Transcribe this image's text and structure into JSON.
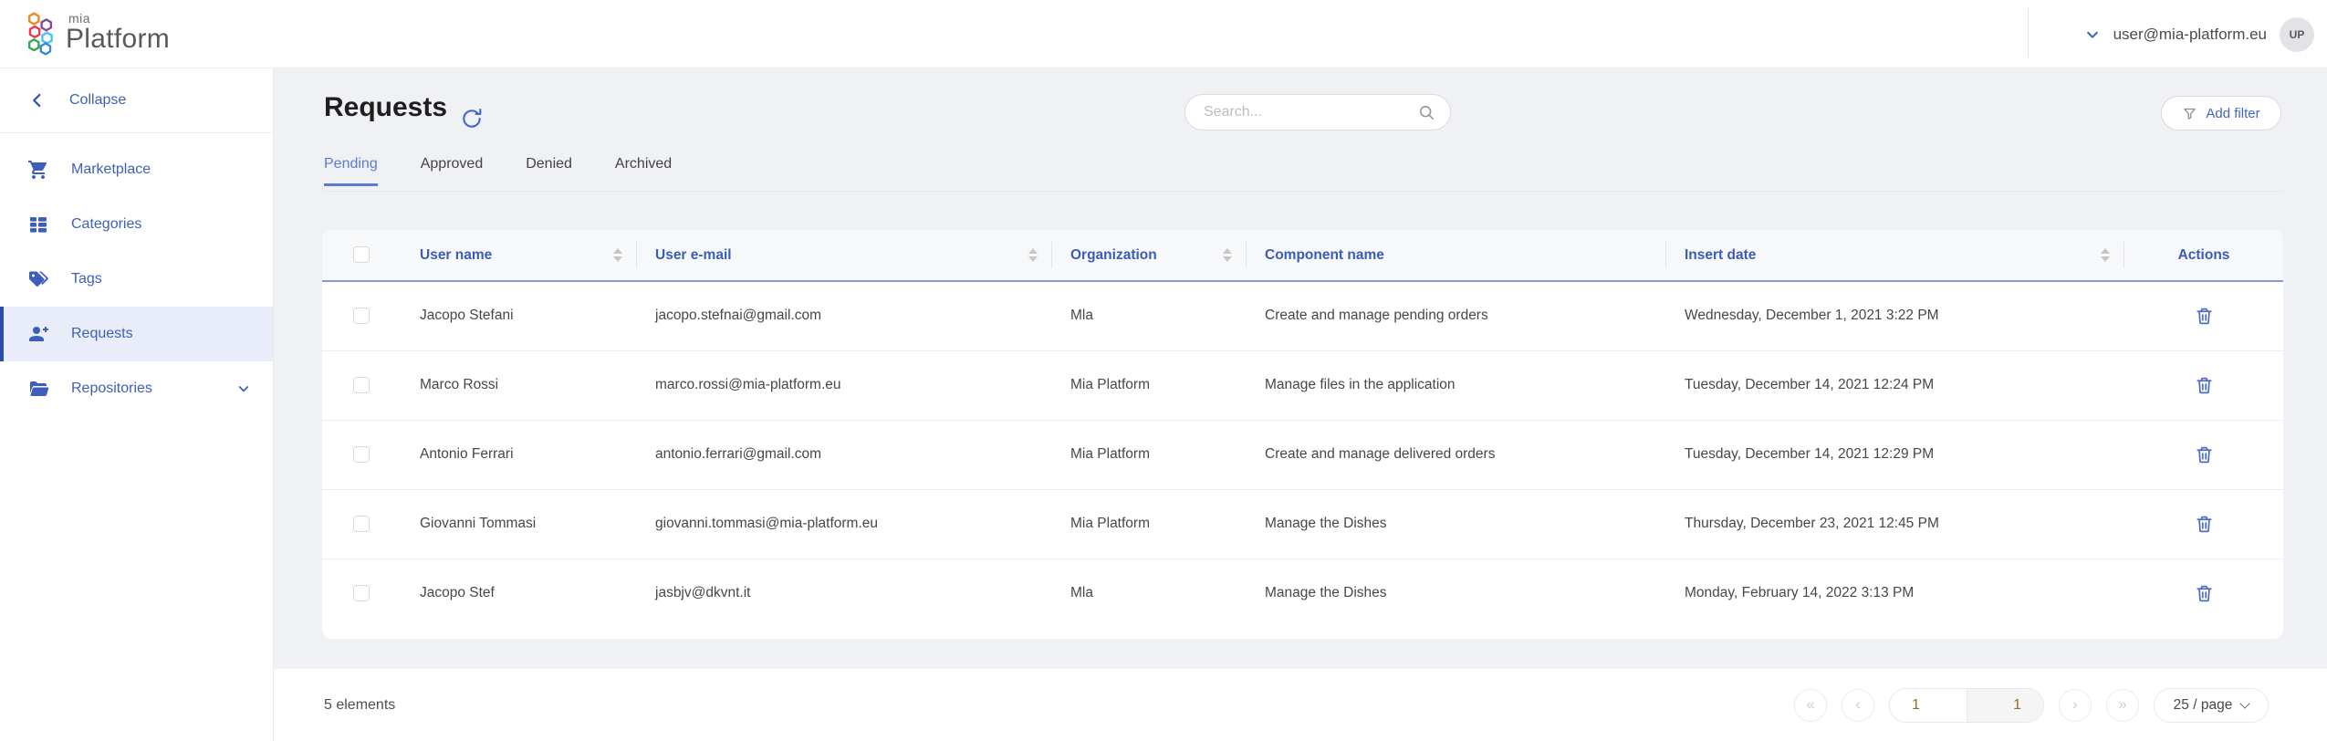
{
  "topbar": {
    "brand": {
      "top": "mia",
      "bottom": "Platform"
    },
    "user": {
      "email": "user@mia-platform.eu",
      "initials": "UP"
    }
  },
  "sidebar": {
    "collapse_label": "Collapse",
    "items": [
      {
        "label": "Marketplace",
        "icon": "cart-icon",
        "active": false
      },
      {
        "label": "Categories",
        "icon": "list-icon",
        "active": false
      },
      {
        "label": "Tags",
        "icon": "tags-icon",
        "active": false
      },
      {
        "label": "Requests",
        "icon": "user-add-icon",
        "active": true
      },
      {
        "label": "Repositories",
        "icon": "folder-icon",
        "active": false,
        "has_submenu": true
      }
    ]
  },
  "page": {
    "title": "Requests",
    "tabs": [
      {
        "label": "Pending",
        "active": true
      },
      {
        "label": "Approved",
        "active": false
      },
      {
        "label": "Denied",
        "active": false
      },
      {
        "label": "Archived",
        "active": false
      }
    ],
    "search_placeholder": "Search...",
    "add_filter_label": "Add filter"
  },
  "table": {
    "columns": [
      {
        "label": "User name",
        "sortable": true
      },
      {
        "label": "User e-mail",
        "sortable": true
      },
      {
        "label": "Organization",
        "sortable": true
      },
      {
        "label": "Component name",
        "sortable": false
      },
      {
        "label": "Insert date",
        "sortable": true
      },
      {
        "label": "Actions",
        "sortable": false
      }
    ],
    "rows": [
      {
        "user_name": "Jacopo Stefani",
        "user_email": "jacopo.stefnai@gmail.com",
        "organization": "Mla",
        "component_name": "Create and manage pending orders",
        "insert_date": "Wednesday, December 1, 2021 3:22 PM"
      },
      {
        "user_name": "Marco Rossi",
        "user_email": "marco.rossi@mia-platform.eu",
        "organization": "Mia Platform",
        "component_name": "Manage files in the application",
        "insert_date": "Tuesday, December 14, 2021 12:24 PM"
      },
      {
        "user_name": "Antonio Ferrari",
        "user_email": "antonio.ferrari@gmail.com",
        "organization": "Mia Platform",
        "component_name": "Create and manage delivered orders",
        "insert_date": "Tuesday, December 14, 2021 12:29 PM"
      },
      {
        "user_name": "Giovanni Tommasi",
        "user_email": "giovanni.tommasi@mia-platform.eu",
        "organization": "Mia Platform",
        "component_name": "Manage the Dishes",
        "insert_date": "Thursday, December 23, 2021 12:45 PM"
      },
      {
        "user_name": "Jacopo Stef",
        "user_email": "jasbjv@dkvnt.it",
        "organization": "Mla",
        "component_name": "Manage the Dishes",
        "insert_date": "Monday, February 14, 2022 3:13 PM"
      }
    ]
  },
  "footer": {
    "total_label": "5 elements",
    "pagination": {
      "first_glyph": "«",
      "prev_glyph": "‹",
      "current_page": "1",
      "total_pages": "1",
      "next_glyph": "›",
      "last_glyph": "»",
      "page_size_label": "25 / page"
    }
  },
  "colors": {
    "accent_blue": "#3d5fba",
    "tab_active_blue": "#5a7ad6",
    "table_header_blue": "#3a5cb8",
    "header_divider_blue": "#7f9bd8",
    "active_nav_bg": "#e9edf9",
    "active_nav_bar": "#2c4da8",
    "main_background": "#f0f1f5",
    "trash_icon_blue": "#4a6cc8"
  }
}
